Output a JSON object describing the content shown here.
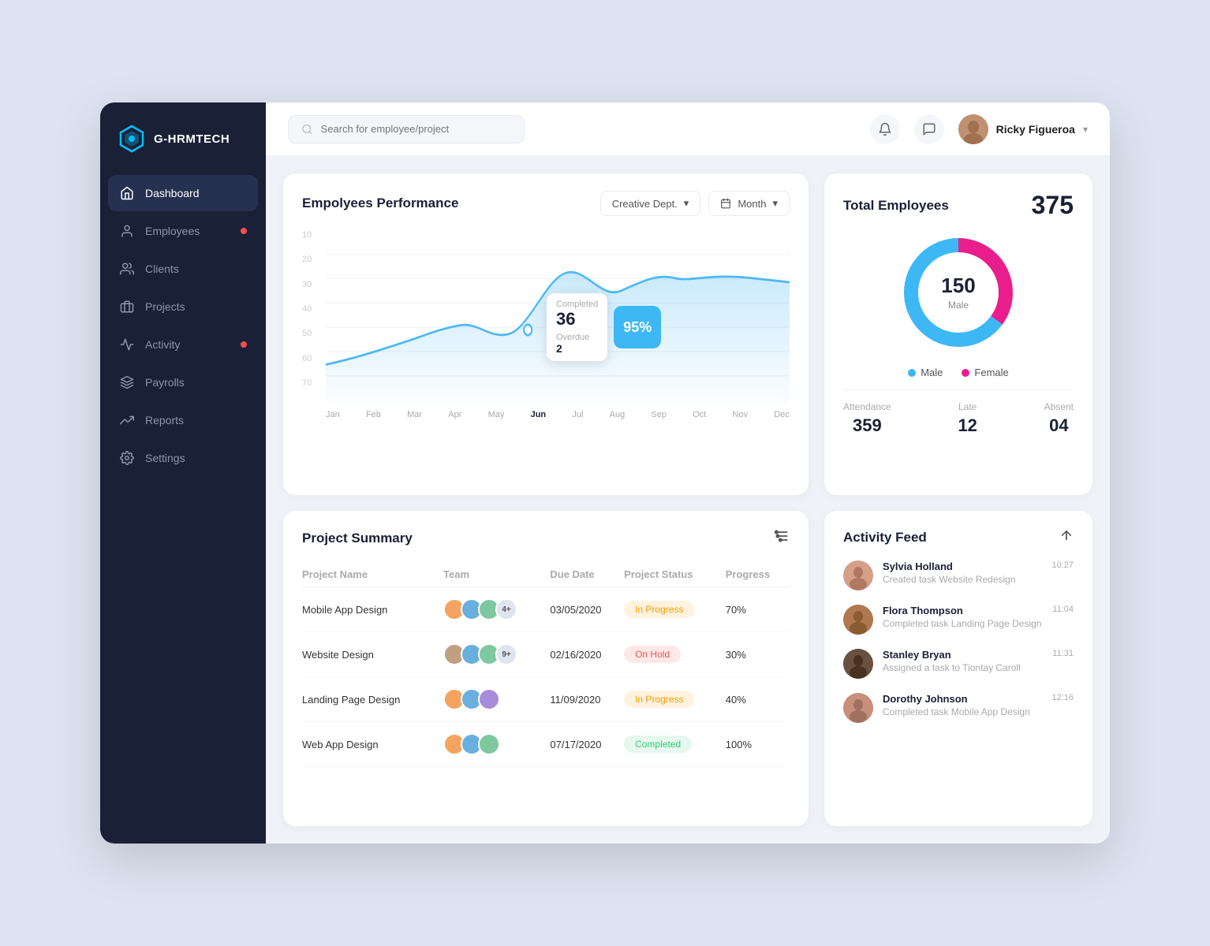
{
  "app": {
    "logo_text": "G-HRMTECH",
    "logo_icon": "⬡"
  },
  "sidebar": {
    "items": [
      {
        "id": "dashboard",
        "label": "Dashboard",
        "icon": "home",
        "active": true,
        "badge": false
      },
      {
        "id": "employees",
        "label": "Employees",
        "icon": "person",
        "active": false,
        "badge": true
      },
      {
        "id": "clients",
        "label": "Clients",
        "icon": "people",
        "active": false,
        "badge": false
      },
      {
        "id": "projects",
        "label": "Projects",
        "icon": "briefcase",
        "active": false,
        "badge": false
      },
      {
        "id": "activity",
        "label": "Activity",
        "icon": "activity",
        "active": false,
        "badge": true
      },
      {
        "id": "payrolls",
        "label": "Payrolls",
        "icon": "layers",
        "active": false,
        "badge": false
      },
      {
        "id": "reports",
        "label": "Reports",
        "icon": "trending",
        "active": false,
        "badge": false
      },
      {
        "id": "settings",
        "label": "Settings",
        "icon": "gear",
        "active": false,
        "badge": false
      }
    ]
  },
  "header": {
    "search_placeholder": "Search for employee/project",
    "user_name": "Ricky Figueroa"
  },
  "performance": {
    "title": "Empolyees Performance",
    "dept_filter": "Creative Dept.",
    "time_filter": "Month",
    "x_labels": [
      "Jan",
      "Feb",
      "Mar",
      "Apr",
      "May",
      "Jun",
      "Jul",
      "Aug",
      "Sep",
      "Oct",
      "Nov",
      "Dec"
    ],
    "active_x": "Jun",
    "y_labels": [
      "10",
      "20",
      "30",
      "40",
      "50",
      "60",
      "70"
    ],
    "tooltip": {
      "completed_label": "Completed",
      "completed_value": "36",
      "overdue_label": "Overdue",
      "overdue_value": "2",
      "percentage": "95%"
    }
  },
  "total_employees": {
    "title": "Total Employees",
    "count": "375",
    "male_count": "150",
    "male_label": "Male",
    "male_color": "#3eb8f5",
    "female_color": "#e91e8c",
    "legend": [
      {
        "label": "Male",
        "color": "#3eb8f5"
      },
      {
        "label": "Female",
        "color": "#e91e8c"
      }
    ],
    "stats": [
      {
        "label": "Attendance",
        "value": "359"
      },
      {
        "label": "Late",
        "value": "12"
      },
      {
        "label": "Absent",
        "value": "04"
      }
    ]
  },
  "project_summary": {
    "title": "Project Summary",
    "columns": [
      "Project Name",
      "Team",
      "Due Date",
      "Project Status",
      "Progress"
    ],
    "rows": [
      {
        "name": "Mobile App Design",
        "team_colors": [
          "#f4a460",
          "#6ab0de",
          "#7ec8a0",
          "#f08080"
        ],
        "team_extra": "4+",
        "due_date": "03/05/2020",
        "status": "In Progress",
        "status_class": "status-inprogress",
        "progress": "70%"
      },
      {
        "name": "Website Design",
        "team_colors": [
          "#c0a080",
          "#6ab0de",
          "#7ec8a0",
          "#f08080"
        ],
        "team_extra": "9+",
        "due_date": "02/16/2020",
        "status": "On Hold",
        "status_class": "status-onhold",
        "progress": "30%"
      },
      {
        "name": "Landing Page Design",
        "team_colors": [
          "#f4a460",
          "#6ab0de",
          "#a88cdb"
        ],
        "team_extra": "",
        "due_date": "11/09/2020",
        "status": "In Progress",
        "status_class": "status-inprogress",
        "progress": "40%"
      },
      {
        "name": "Web App Design",
        "team_colors": [
          "#f4a460",
          "#6ab0de",
          "#7ec8a0"
        ],
        "team_extra": "",
        "due_date": "07/17/2020",
        "status": "Completed",
        "status_class": "status-completed",
        "progress": "100%"
      }
    ]
  },
  "activity_feed": {
    "title": "Activity Feed",
    "items": [
      {
        "name": "Sylvia Holland",
        "desc": "Created task Website Redesign",
        "time": "10:27",
        "avatar_bg": "#c9a07a",
        "avatar_text": "👩"
      },
      {
        "name": "Flora Thompson",
        "desc": "Completed task Landing Page Design",
        "time": "11:04",
        "avatar_bg": "#b07850",
        "avatar_text": "👩"
      },
      {
        "name": "Stanley Bryan",
        "desc": "Assigned a task to Tiontay Caroll",
        "time": "11:31",
        "avatar_bg": "#5a4030",
        "avatar_text": "👨"
      },
      {
        "name": "Dorothy Johnson",
        "desc": "Completed task Mobile App Design",
        "time": "12:16",
        "avatar_bg": "#c8907a",
        "avatar_text": "👩"
      }
    ]
  }
}
